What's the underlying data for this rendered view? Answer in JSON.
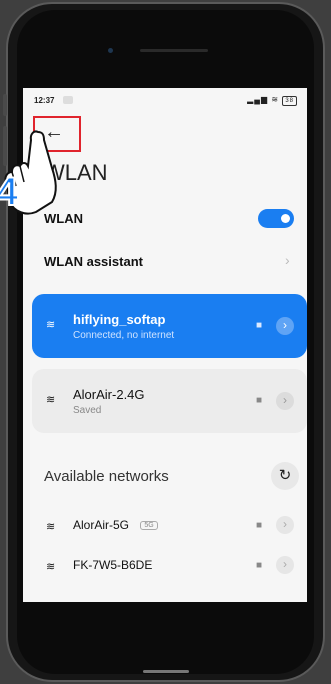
{
  "status_bar": {
    "time": "12:37",
    "signal": "☰ᴵᴵ",
    "battery": "38"
  },
  "header": {
    "title": "WLAN"
  },
  "wlan_toggle": {
    "label": "WLAN",
    "enabled": true
  },
  "wlan_assistant": {
    "label": "WLAN assistant"
  },
  "connected_network": {
    "name": "hiflying_softap",
    "status": "Connected, no internet"
  },
  "saved_network": {
    "name": "AlorAir-2.4G",
    "status": "Saved"
  },
  "available": {
    "title": "Available networks",
    "networks": [
      {
        "name": "AlorAir-5G",
        "badge": "5G"
      },
      {
        "name": "FK-7W5-B6DE",
        "badge": ""
      }
    ]
  },
  "annotation": {
    "step_number": "4"
  },
  "colors": {
    "accent": "#1a7ef1",
    "highlight_box": "#e0242d"
  }
}
